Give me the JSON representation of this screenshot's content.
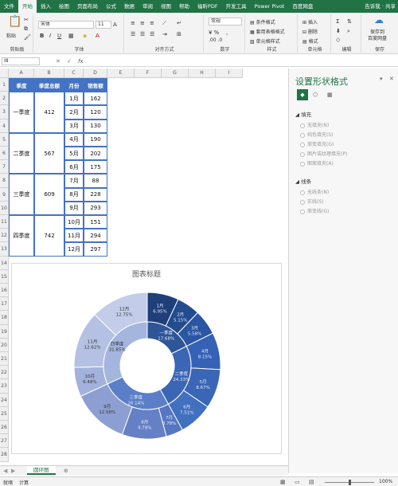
{
  "tabs": [
    "文件",
    "开始",
    "插入",
    "绘图",
    "页面布局",
    "公式",
    "数据",
    "审阅",
    "视图",
    "帮助",
    "福昕PDF",
    "开发工具",
    "Power Pivot",
    "百度网盘"
  ],
  "active_tab": "开始",
  "tell_me": "告诉我",
  "share": "共享",
  "ribbon": {
    "clipboard": {
      "paste": "粘贴",
      "label": "剪贴板"
    },
    "font": {
      "name": "宋体",
      "size": "11",
      "label": "字体"
    },
    "align": {
      "label": "对齐方式"
    },
    "number": {
      "format": "常规",
      "label": "数字"
    },
    "styles": {
      "cond": "条件格式",
      "table": "套用表格格式",
      "cell": "单元格样式",
      "label": "样式"
    },
    "cells": {
      "insert": "插入",
      "delete": "删除",
      "format": "格式",
      "label": "单元格"
    },
    "edit": {
      "label": "编辑"
    },
    "save": {
      "line1": "保存到",
      "line2": "百度网盘",
      "label": "保存"
    }
  },
  "formula_bar": {
    "name_box": "I8",
    "fx": "fx",
    "value": ""
  },
  "columns": [
    "A",
    "B",
    "C",
    "D",
    "E",
    "F",
    "G",
    "H",
    "I"
  ],
  "rows": [
    "1",
    "2",
    "3",
    "4",
    "5",
    "6",
    "7",
    "8",
    "9",
    "10",
    "11",
    "12",
    "13",
    "14",
    "15",
    "16",
    "17",
    "18",
    "19",
    "20",
    "21",
    "22",
    "23",
    "24",
    "25",
    "26",
    "27",
    "28"
  ],
  "table": {
    "headers": [
      "季度",
      "季度总额",
      "月份",
      "销售额"
    ],
    "quarters": [
      {
        "name": "一季度",
        "total": "412",
        "months": [
          [
            "1月",
            "162"
          ],
          [
            "2月",
            "120"
          ],
          [
            "3月",
            "130"
          ]
        ]
      },
      {
        "name": "二季度",
        "total": "567",
        "months": [
          [
            "4月",
            "190"
          ],
          [
            "5月",
            "202"
          ],
          [
            "6月",
            "175"
          ]
        ]
      },
      {
        "name": "三季度",
        "total": "609",
        "months": [
          [
            "7月",
            "88"
          ],
          [
            "8月",
            "228"
          ],
          [
            "9月",
            "293"
          ]
        ]
      },
      {
        "name": "四季度",
        "total": "742",
        "months": [
          [
            "10月",
            "151"
          ],
          [
            "11月",
            "294"
          ],
          [
            "12月",
            "297"
          ]
        ]
      }
    ]
  },
  "chart_data": {
    "type": "pie",
    "title": "图表标题",
    "inner": {
      "categories": [
        "一季度",
        "二季度",
        "三季度",
        "四季度"
      ],
      "values": [
        412,
        567,
        609,
        742
      ],
      "labels": [
        "一季度\n17.68%",
        "二季度\n24.33%",
        "三季度\n26.14%",
        "四季度\n31.85%"
      ]
    },
    "outer": {
      "categories": [
        "1月",
        "2月",
        "3月",
        "4月",
        "5月",
        "6月",
        "7月",
        "8月",
        "9月",
        "10月",
        "11月",
        "12月"
      ],
      "values": [
        162,
        120,
        130,
        190,
        202,
        175,
        88,
        228,
        293,
        151,
        294,
        297
      ],
      "labels": [
        "1月\n6.95%",
        "2月\n5.15%",
        "3月\n5.58%",
        "4月\n8.15%",
        "5月\n8.67%",
        "6月\n7.51%",
        "7月\n3.78%",
        "8月\n9.79%",
        "9月\n12.58%",
        "10月\n6.48%",
        "11月\n12.62%",
        "12月\n12.75%"
      ]
    },
    "colors": {
      "inner": [
        "#2e5597",
        "#3a66b5",
        "#5b7ec8",
        "#a4b6de"
      ],
      "outer": [
        "#1f3f7a",
        "#234b8f",
        "#2a56a3",
        "#3562b5",
        "#3a66b5",
        "#4270c0",
        "#5676c2",
        "#6680c5",
        "#8d9fd2",
        "#a3b2dc",
        "#b4c1e3",
        "#c3cdea"
      ]
    }
  },
  "pane": {
    "title": "设置形状格式",
    "fill_header": "填充",
    "fill_opts": [
      "无填充(N)",
      "纯色填充(S)",
      "渐变填充(G)",
      "图片或纹理填充(P)",
      "图案填充(A)"
    ],
    "line_header": "线条",
    "line_opts": [
      "无线条(N)",
      "实线(S)",
      "渐变线(G)"
    ]
  },
  "sheet_tab": "圆环图",
  "status": {
    "ready": "就绪",
    "calc": "计算",
    "zoom": "100%"
  }
}
